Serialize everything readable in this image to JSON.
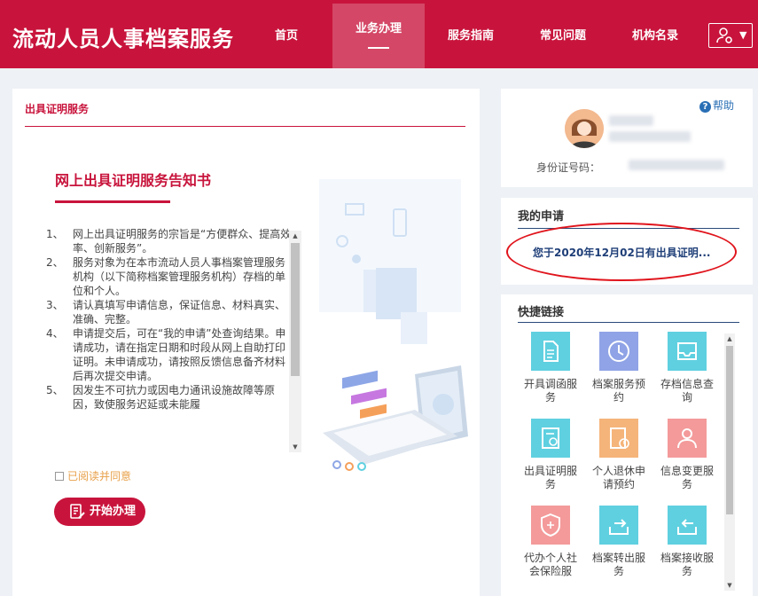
{
  "header": {
    "title": "流动人员人事档案服务",
    "nav": [
      {
        "label": "首页",
        "active": false
      },
      {
        "label": "业务办理",
        "active": true
      },
      {
        "label": "服务指南",
        "active": false
      },
      {
        "label": "常见问题",
        "active": false
      },
      {
        "label": "机构名录",
        "active": false
      }
    ],
    "user_icon": "user-gear-icon",
    "accent": "#c8143c"
  },
  "left_panel": {
    "section_title": "出具证明服务",
    "notice_title": "网上出具证明服务告知书",
    "notice_items": [
      {
        "num": "1、",
        "text": "网上出具证明服务的宗旨是“方便群众、提高效率、创新服务”。"
      },
      {
        "num": "2、",
        "text": "服务对象为在本市流动人员人事档案管理服务机构（以下简称档案管理服务机构）存档的单位和个人。"
      },
      {
        "num": "3、",
        "text": "请认真填写申请信息，保证信息、材料真实、准确、完整。"
      },
      {
        "num": "4、",
        "text": "申请提交后，可在“我的申请”处查询结果。申请成功，请在指定日期和时段从网上自助打印证明。未申请成功，请按照反馈信息备齐材料后再次提交申请。"
      },
      {
        "num": "5、",
        "text": "因发生不可抗力或因电力通讯设施故障等原因，致使服务迟延或未能履"
      }
    ],
    "agree_label": "已阅读并同意",
    "start_button": "开始办理"
  },
  "profile": {
    "help_label": "帮助",
    "id_label": "身份证号码："
  },
  "my_applications": {
    "title": "我的申请",
    "items": [
      "您于2020年12月02日有出具证明..."
    ],
    "highlight_color": "#e0141c"
  },
  "quick_links": {
    "title": "快捷链接",
    "items": [
      {
        "label": "开具调函服务",
        "icon": "document-icon",
        "color": "#5fd0e0"
      },
      {
        "label": "档案服务预约",
        "icon": "clock-icon",
        "color": "#8fa3e6"
      },
      {
        "label": "存档信息查询",
        "icon": "inbox-icon",
        "color": "#5fd0e0"
      },
      {
        "label": "出具证明服务",
        "icon": "certificate-icon",
        "color": "#5fd0e0"
      },
      {
        "label": "个人退休申请预约",
        "icon": "retire-doc-icon",
        "color": "#f5b47a"
      },
      {
        "label": "信息变更服务",
        "icon": "person-edit-icon",
        "color": "#f49a9a"
      },
      {
        "label": "代办个人社会保险服",
        "icon": "shield-icon",
        "color": "#f49a9a"
      },
      {
        "label": "档案转出服务",
        "icon": "tray-out-icon",
        "color": "#5fd0e0"
      },
      {
        "label": "档案接收服务",
        "icon": "tray-in-icon",
        "color": "#5fd0e0"
      }
    ]
  }
}
